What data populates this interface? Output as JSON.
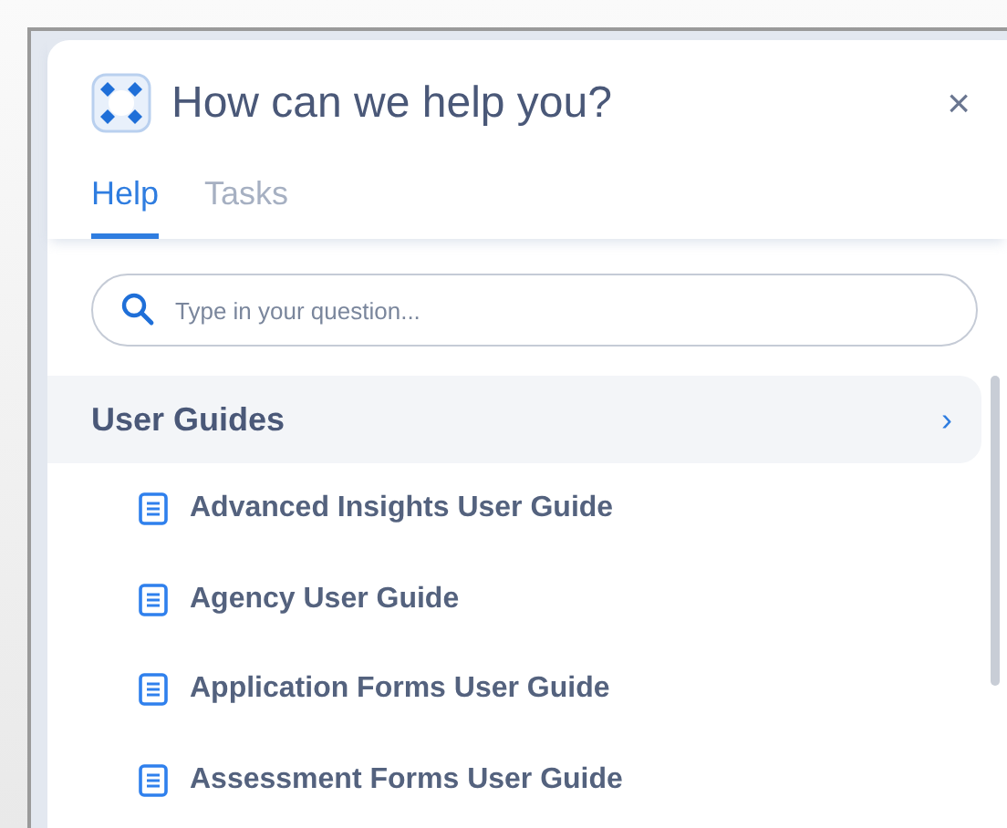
{
  "header": {
    "title": "How can we help you?",
    "close": "×"
  },
  "tabs": [
    {
      "label": "Help",
      "selected": true
    },
    {
      "label": "Tasks",
      "selected": false
    }
  ],
  "search": {
    "placeholder": "Type in your question..."
  },
  "section": {
    "title": "User Guides",
    "chevron": "›",
    "items": [
      {
        "label": "Advanced Insights User Guide"
      },
      {
        "label": "Agency User Guide"
      },
      {
        "label": "Application Forms User Guide"
      },
      {
        "label": "Assessment Forms User Guide"
      }
    ]
  }
}
